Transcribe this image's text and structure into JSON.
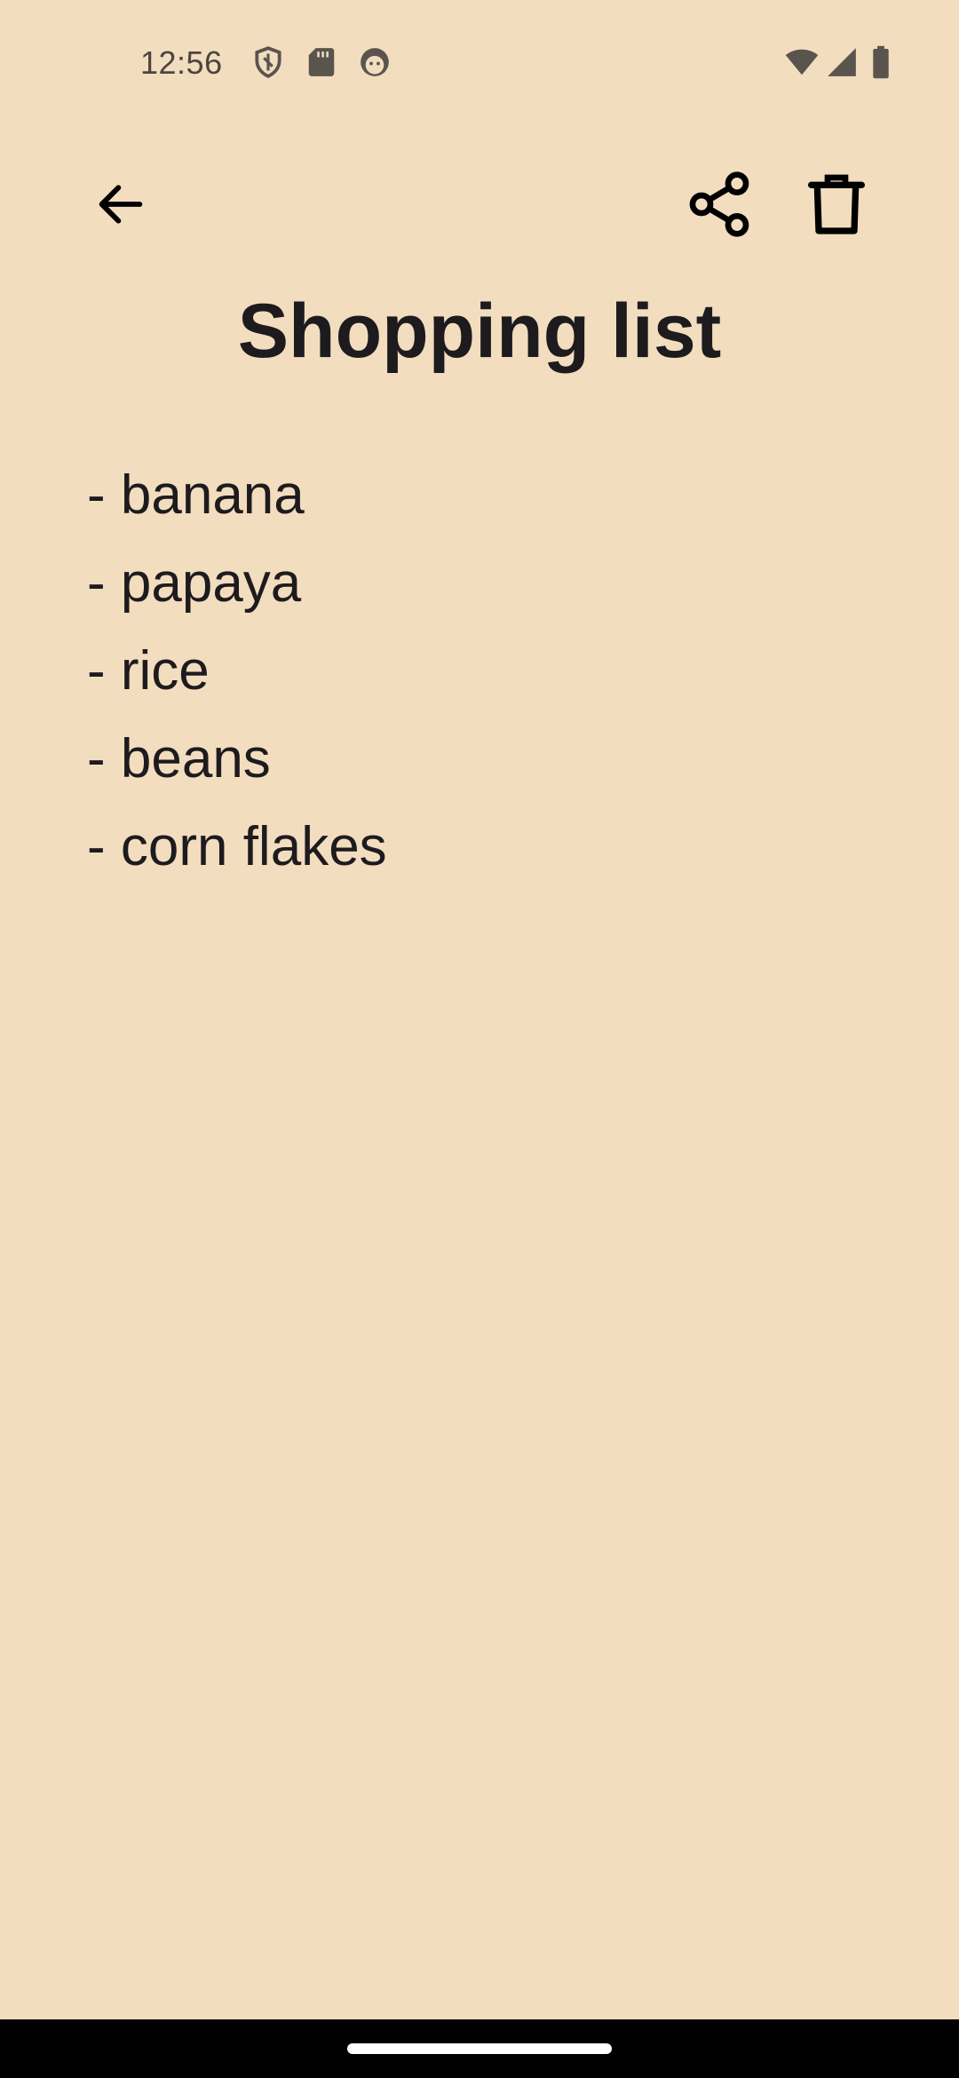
{
  "status_bar": {
    "time": "12:56",
    "left_icons": [
      "shield-icon",
      "sd-card-icon",
      "face-icon"
    ],
    "right_icons": [
      "wifi-icon",
      "cell-signal-icon",
      "battery-icon"
    ]
  },
  "toolbar": {
    "back_icon": "arrow-back-icon",
    "share_icon": "share-icon",
    "delete_icon": "trash-icon"
  },
  "note": {
    "title": "Shopping list",
    "lines": [
      "- banana",
      "- papaya",
      "- rice",
      "- beans",
      "- corn flakes"
    ]
  },
  "colors": {
    "background": "#f3ddbf",
    "text": "#1d1b1e",
    "nav_bar": "#000000"
  }
}
